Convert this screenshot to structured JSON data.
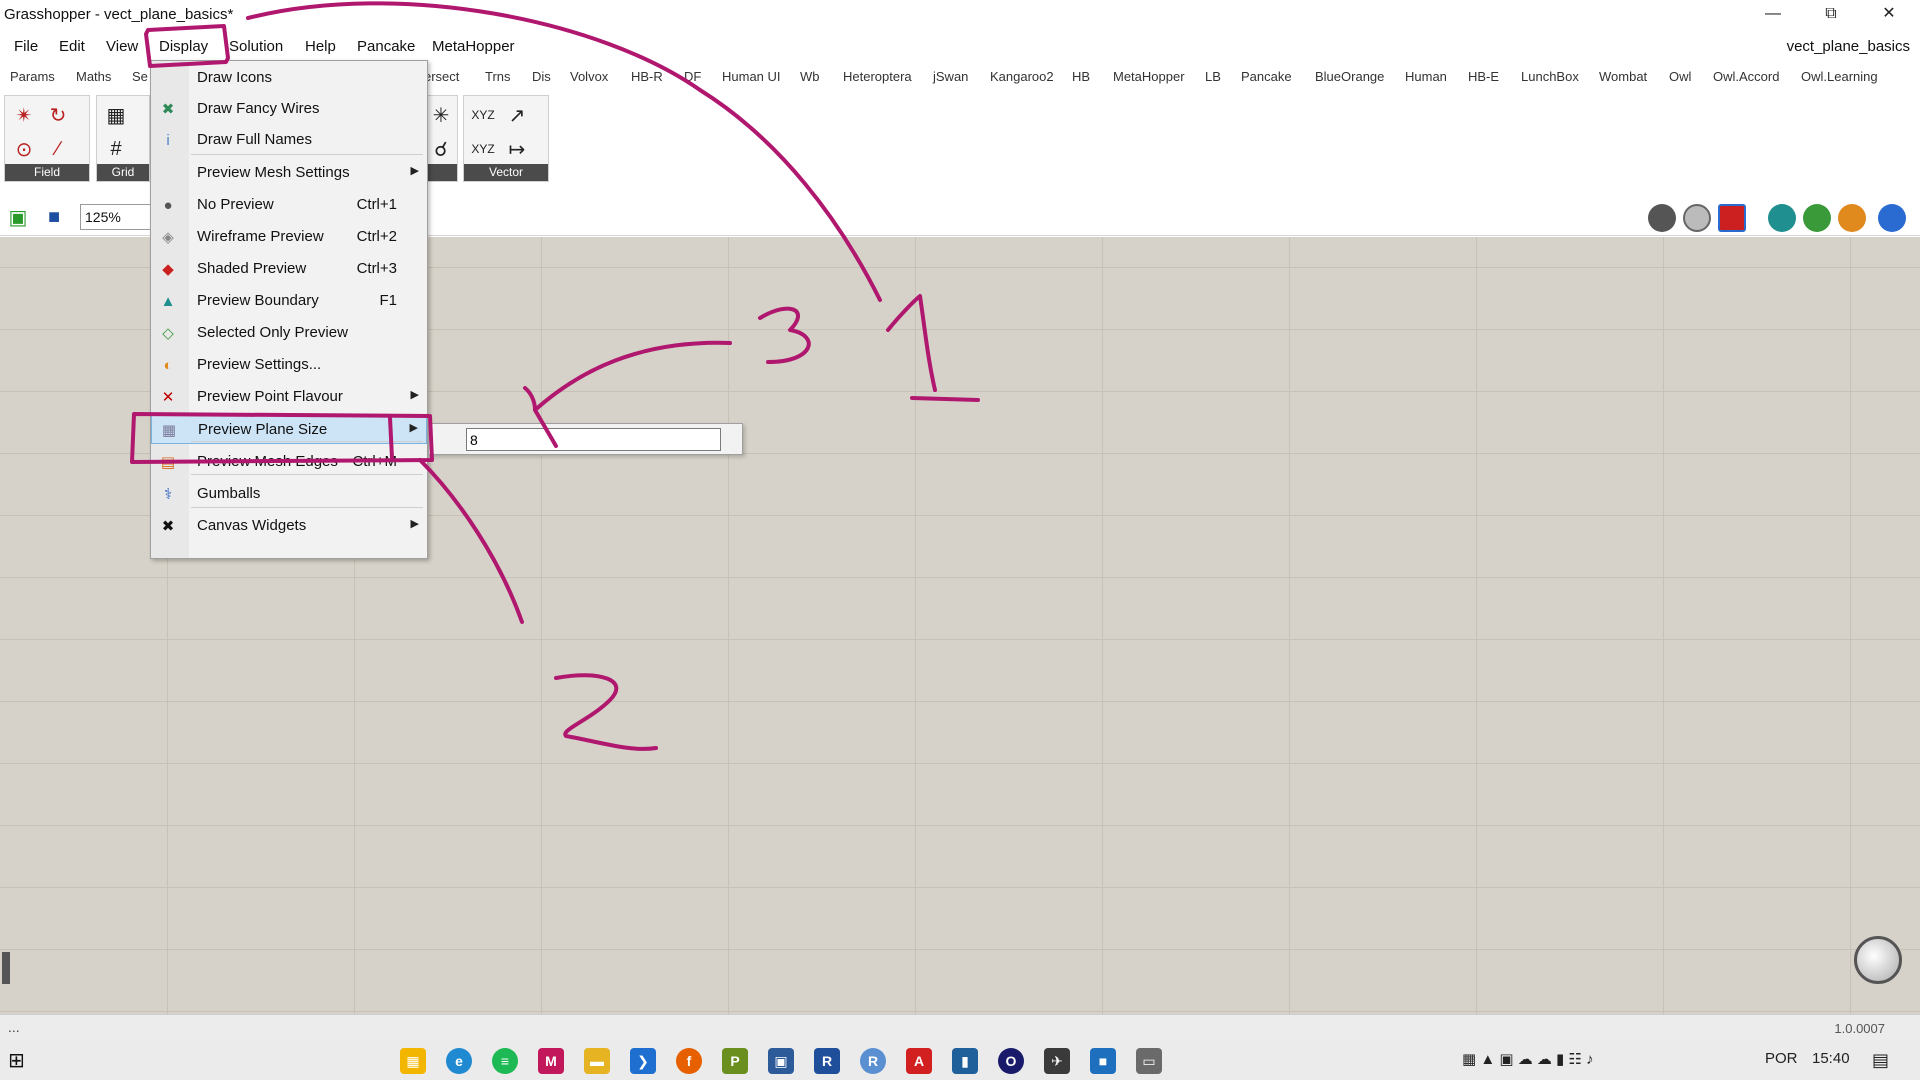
{
  "window": {
    "title": "Grasshopper - vect_plane_basics*",
    "minimize": "—",
    "restore": "⧉",
    "close": "✕"
  },
  "menubar": {
    "items": [
      "File",
      "Edit",
      "View",
      "Display",
      "Solution",
      "Help",
      "Pancake",
      "MetaHopper"
    ],
    "document_name": "vect_plane_basics"
  },
  "component_tabs": [
    "Params",
    "Maths",
    "Se",
    "ersect",
    "Trns",
    "Dis",
    "Volvox",
    "HB-R",
    "DF",
    "Human UI",
    "Wb",
    "Heteroptera",
    "jSwan",
    "Kangaroo2",
    "HB",
    "MetaHopper",
    "LB",
    "Pancake",
    "BlueOrange",
    "Human",
    "HB-E",
    "LunchBox",
    "Wombat",
    "Owl",
    "Owl.Accord",
    "Owl.Learning"
  ],
  "ribbon": {
    "panels": [
      {
        "caption": "Field",
        "icons": [
          "magnet-icon",
          "magnet-spin-icon",
          "point-charge-icon",
          "line-charge-icon"
        ]
      },
      {
        "caption": "Grid",
        "icons": [
          "square-grid-icon",
          "grid-icon"
        ]
      },
      {
        "caption": "",
        "icons": [
          "plane-points-icon",
          "plane-circle-icon"
        ]
      },
      {
        "caption": "Vector",
        "icons": [
          "vector-xyz-icon",
          "vector-2pt-icon",
          "unit-xyz-icon",
          "amplitude-icon"
        ]
      }
    ]
  },
  "canvas_toolbar": {
    "zoom": "125%"
  },
  "display_menu": {
    "items": [
      {
        "label": "Draw Icons",
        "shortcut": "",
        "submenu": false,
        "icon": "draw-icons-icon",
        "color": "#e8e8e8"
      },
      {
        "label": "Draw Fancy Wires",
        "shortcut": "",
        "submenu": false,
        "icon": "fancy-wires-icon",
        "color": "#2e8b57"
      },
      {
        "label": "Draw Full Names",
        "shortcut": "",
        "submenu": false,
        "icon": "info-icon",
        "color": "#4a7fc1"
      },
      {
        "label": "Preview Mesh Settings",
        "shortcut": "",
        "submenu": true,
        "icon": "",
        "color": ""
      },
      {
        "label": "No Preview",
        "shortcut": "Ctrl+1",
        "submenu": false,
        "icon": "no-preview-icon",
        "color": "#555555"
      },
      {
        "label": "Wireframe Preview",
        "shortcut": "Ctrl+2",
        "submenu": false,
        "icon": "wireframe-icon",
        "color": "#888888"
      },
      {
        "label": "Shaded Preview",
        "shortcut": "Ctrl+3",
        "submenu": false,
        "icon": "shaded-icon",
        "color": "#cc1f1f"
      },
      {
        "label": "Preview Boundary",
        "shortcut": "F1",
        "submenu": false,
        "icon": "boundary-icon",
        "color": "#1f8f8f"
      },
      {
        "label": "Selected Only Preview",
        "shortcut": "",
        "submenu": false,
        "icon": "selected-only-icon",
        "color": "#3a9a3a"
      },
      {
        "label": "Preview Settings...",
        "shortcut": "",
        "submenu": false,
        "icon": "settings-sphere-icon",
        "color": "#e08a1e"
      },
      {
        "label": "Preview Point Flavour",
        "shortcut": "",
        "submenu": true,
        "icon": "point-x-icon",
        "color": "#c00000"
      },
      {
        "label": "Preview Plane Size",
        "shortcut": "",
        "submenu": true,
        "icon": "plane-size-icon",
        "color": "#7a7a9a"
      },
      {
        "label": "Preview Mesh Edges",
        "shortcut": "Ctrl+M",
        "submenu": false,
        "icon": "mesh-edges-icon",
        "color": "#d46a1a"
      },
      {
        "label": "Gumballs",
        "shortcut": "",
        "submenu": false,
        "icon": "gumball-icon",
        "color": "#2a5fbf"
      },
      {
        "label": "Canvas Widgets",
        "shortcut": "",
        "submenu": true,
        "icon": "widgets-icon",
        "color": "#111111"
      }
    ]
  },
  "plane_size_submenu": {
    "value": "8"
  },
  "annotations": [
    "1",
    "2",
    "3"
  ],
  "status": {
    "left": "...",
    "version": "1.0.0007"
  },
  "taskbar": {
    "language": "POR",
    "time": "15:40"
  },
  "colors": {
    "annotation": "#b0176e",
    "menu_highlight": "#cde4f7"
  }
}
